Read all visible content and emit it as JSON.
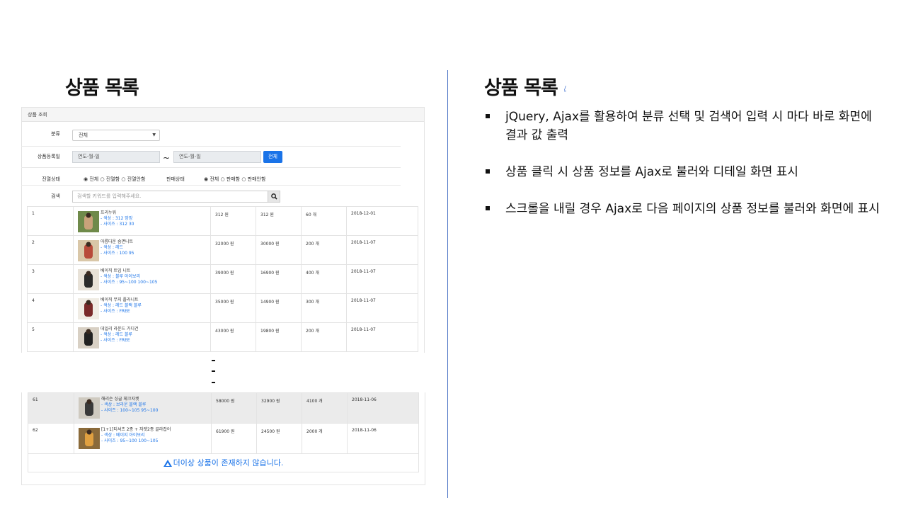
{
  "left_title": "상품 목록",
  "right_title": "상품 목록",
  "right_title_link": "/",
  "bullets": [
    "jQuery, Ajax를 활용하여 분류 선택 및 검색어 입력 시 마다 바로 화면에 결과 값 출력",
    "상품 클릭 시 상품 정보를 Ajax로 불러와  디테일 화면 표시",
    "스크롤을 내릴 경우 Ajax로 다음 페이지의 상품 정보를 불러와 화면에 표시"
  ],
  "screenshot": {
    "panel_title": "상품 조회",
    "category_label": "분류",
    "category_value": "전체",
    "date_label": "상품등록일",
    "date_from_placeholder": "연도-월-일",
    "date_to_placeholder": "연도-월-일",
    "date_tilde": "~",
    "all_button": "전체",
    "display_label": "진열상태",
    "display_options": "◉ 전체 ○ 진열함 ○ 진열안함",
    "sales_label": "판매상태",
    "sales_options": "◉ 전체 ○ 판매함 ○ 판매안함",
    "search_label": "검색",
    "search_placeholder": "검색할 키워드를 입력해주세요.",
    "products_top": [
      {
        "no": "1",
        "name": "프리누워",
        "color": "- 색상 : 312 망망",
        "size": "- 사이즈 : 312 30",
        "price": "312 원",
        "sale_price": "312 원",
        "stock": "60 개",
        "date": "2018-12-01"
      },
      {
        "no": "2",
        "name": "아름다운 솜면니트",
        "color": "- 색상 : 레드",
        "size": "- 사이즈 : 100 95",
        "price": "32000 원",
        "sale_price": "30000 원",
        "stock": "200 개",
        "date": "2018-11-07"
      },
      {
        "no": "3",
        "name": "베이직 트임 니트",
        "color": "- 색상 : 블루 아이보리",
        "size": "- 사이즈 : 95~100 100~105",
        "price": "39000 원",
        "sale_price": "16900 원",
        "stock": "400 개",
        "date": "2018-11-07"
      },
      {
        "no": "4",
        "name": "베이직 무지 플라니트",
        "color": "- 색상 : 레드 블랙 블루",
        "size": "- 사이즈 : FREE",
        "price": "35000 원",
        "sale_price": "14900 원",
        "stock": "300 개",
        "date": "2018-11-07"
      },
      {
        "no": "5",
        "name": "데일리 라운드 가디건",
        "color": "- 색상 : 레드 블루",
        "size": "- 사이즈 : FREE",
        "price": "43000 원",
        "sale_price": "19800 원",
        "stock": "200 개",
        "date": "2018-11-07"
      }
    ],
    "products_bottom": [
      {
        "no": "61",
        "name": "해리슨 싱글 체크자켓",
        "color": "- 색상 : 브라운 블랙 블루",
        "size": "- 사이즈 : 100~105 95~100",
        "price": "58000 원",
        "sale_price": "32900 원",
        "stock": "4100 개",
        "date": "2018-11-06"
      },
      {
        "no": "62",
        "name": "[1+1]티셔츠 2종 + 자켓2종 골라잡어",
        "color": "- 색상 : 베이지 아이보리",
        "size": "- 사이즈 : 95~100 100~105",
        "price": "61900 원",
        "sale_price": "24500 원",
        "stock": "2000 개",
        "date": "2018-11-06"
      }
    ],
    "no_more_message": "더이상 상품이 존재하지 않습니다."
  }
}
